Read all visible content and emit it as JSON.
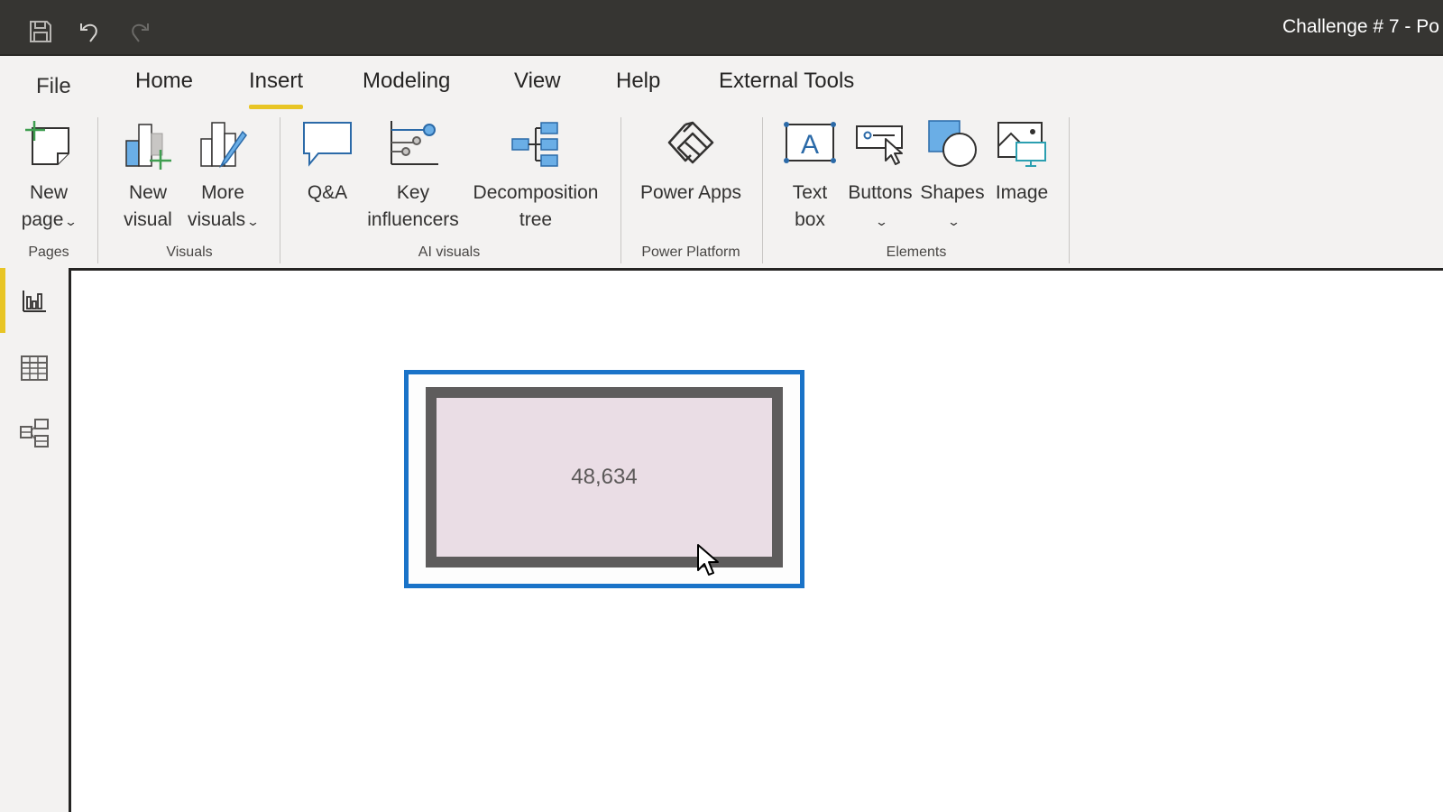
{
  "titlebar": {
    "title": "Challenge # 7 - Po",
    "quick_access": [
      {
        "name": "save",
        "icon": "save-icon"
      },
      {
        "name": "undo",
        "icon": "undo-icon"
      },
      {
        "name": "redo",
        "icon": "redo-icon"
      }
    ]
  },
  "tabs": [
    {
      "label": "File"
    },
    {
      "label": "Home"
    },
    {
      "label": "Insert",
      "active": true
    },
    {
      "label": "Modeling"
    },
    {
      "label": "View"
    },
    {
      "label": "Help"
    },
    {
      "label": "External Tools"
    }
  ],
  "ribbon": {
    "groups": [
      {
        "label": "Pages",
        "buttons": [
          {
            "line1": "New",
            "line2": "page",
            "dropdown": true,
            "icon": "new-page-icon"
          }
        ]
      },
      {
        "label": "Visuals",
        "buttons": [
          {
            "line1": "New",
            "line2": "visual",
            "icon": "new-visual-icon"
          },
          {
            "line1": "More",
            "line2": "visuals",
            "dropdown": true,
            "icon": "more-visuals-icon"
          }
        ]
      },
      {
        "label": "AI visuals",
        "buttons": [
          {
            "line1": "Q&A",
            "line2": "",
            "icon": "qna-icon"
          },
          {
            "line1": "Key",
            "line2": "influencers",
            "icon": "key-influencers-icon"
          },
          {
            "line1": "Decomposition",
            "line2": "tree",
            "icon": "decomposition-tree-icon"
          }
        ]
      },
      {
        "label": "Power Platform",
        "buttons": [
          {
            "line1": "Power Apps",
            "line2": "",
            "icon": "power-apps-icon"
          }
        ]
      },
      {
        "label": "Elements",
        "buttons": [
          {
            "line1": "Text",
            "line2": "box",
            "icon": "text-box-icon"
          },
          {
            "line1": "Buttons",
            "line2": "",
            "dropdown": true,
            "icon": "buttons-icon"
          },
          {
            "line1": "Shapes",
            "line2": "",
            "dropdown": true,
            "icon": "shapes-icon"
          },
          {
            "line1": "Image",
            "line2": "",
            "icon": "image-icon"
          }
        ]
      }
    ],
    "dropdown_glyph": "⌄"
  },
  "leftnav": {
    "items": [
      {
        "name": "report-view",
        "icon": "report-view-icon",
        "active": true
      },
      {
        "name": "data-view",
        "icon": "data-view-icon"
      },
      {
        "name": "model-view",
        "icon": "model-view-icon"
      }
    ]
  },
  "canvas": {
    "selected_visual": {
      "type": "shape",
      "value": "48,634"
    }
  },
  "colors": {
    "accent_yellow": "#e8c525",
    "selection_blue": "#1a73c8",
    "shape_fill": "#eadde5",
    "shape_border": "#5e5c5c",
    "titlebar_bg": "#363532",
    "icon_blue": "#5b9bd5"
  }
}
